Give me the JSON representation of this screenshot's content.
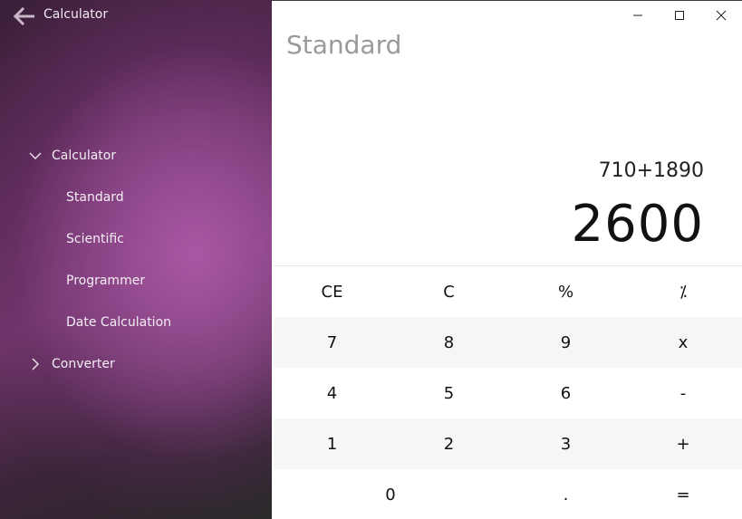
{
  "app": {
    "title": "Calculator"
  },
  "sidebar": {
    "groups": [
      {
        "label": "Calculator",
        "expanded": true,
        "items": [
          "Standard",
          "Scientific",
          "Programmer",
          "Date Calculation"
        ]
      },
      {
        "label": "Converter",
        "expanded": false,
        "items": []
      }
    ]
  },
  "main": {
    "mode": "Standard",
    "expression": "710+1890",
    "result": "2600"
  },
  "keypad": {
    "rows": [
      [
        "CE",
        "C",
        "%",
        "⁒"
      ],
      [
        "7",
        "8",
        "9",
        "x"
      ],
      [
        "4",
        "5",
        "6",
        "-"
      ],
      [
        "1",
        "2",
        "3",
        "+"
      ],
      [
        "0",
        ".",
        "="
      ]
    ]
  },
  "colors": {
    "sidebar_accent": "#6e3468",
    "title_gray": "#9a9a9a",
    "key_row_shade": "#f6f6f6"
  }
}
